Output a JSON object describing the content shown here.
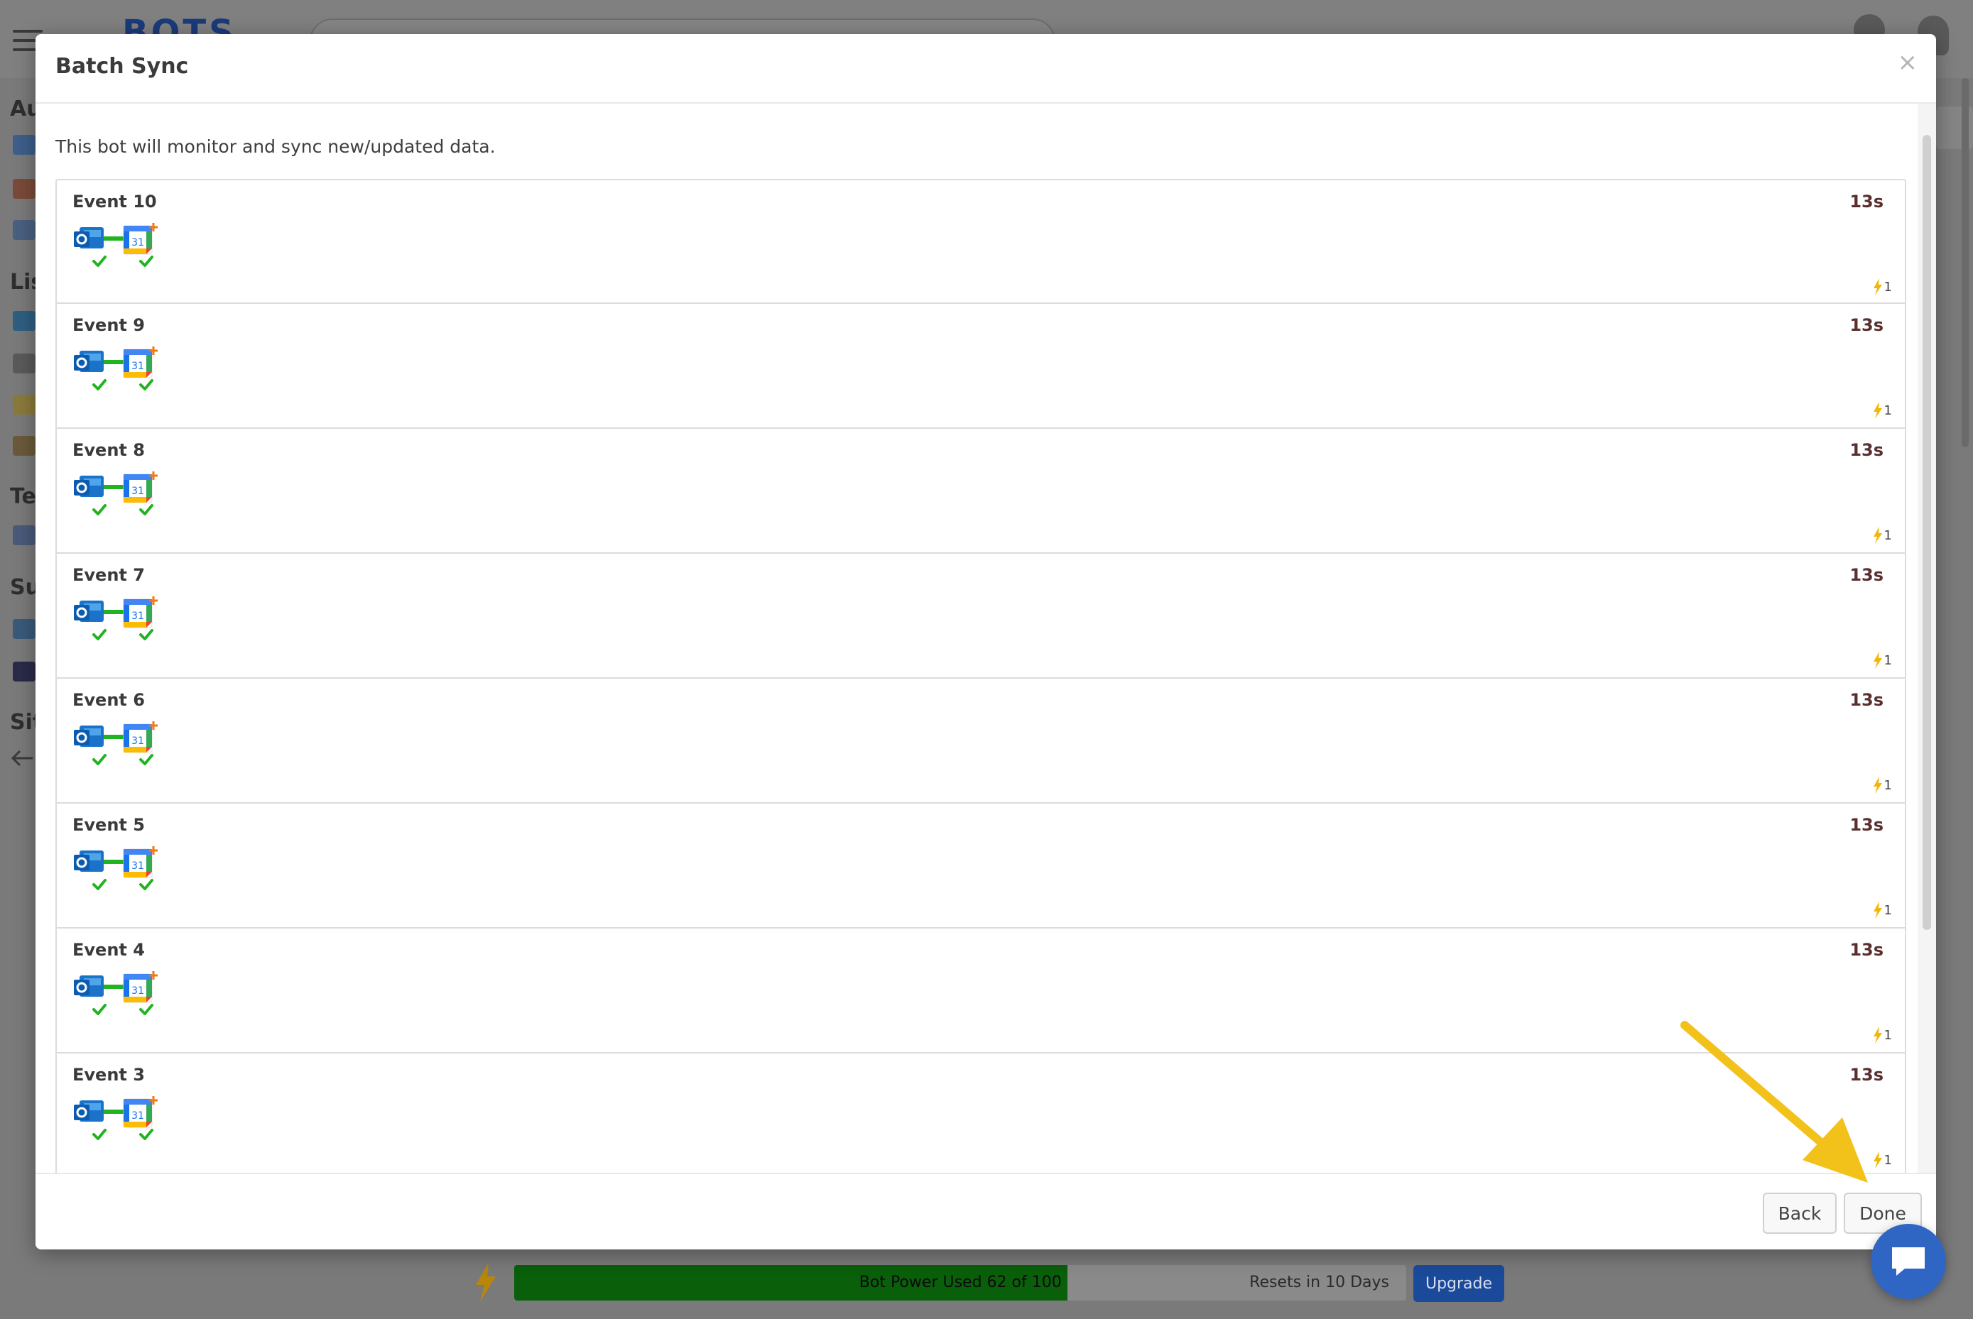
{
  "app": {
    "logo_text": "BOTS",
    "sidebar_headers": [
      "Au",
      "Lis",
      "Te",
      "Su",
      "Sit"
    ]
  },
  "modal": {
    "title": "Batch Sync",
    "close_glyph": "×",
    "intro": "This bot will monitor and sync new/updated data.",
    "events": [
      {
        "name": "Event 10",
        "time": "13s",
        "power": "1"
      },
      {
        "name": "Event 9",
        "time": "13s",
        "power": "1"
      },
      {
        "name": "Event 8",
        "time": "13s",
        "power": "1"
      },
      {
        "name": "Event 7",
        "time": "13s",
        "power": "1"
      },
      {
        "name": "Event 6",
        "time": "13s",
        "power": "1"
      },
      {
        "name": "Event 5",
        "time": "13s",
        "power": "1"
      },
      {
        "name": "Event 4",
        "time": "13s",
        "power": "1"
      },
      {
        "name": "Event 3",
        "time": "13s",
        "power": "1"
      }
    ],
    "icons": {
      "source": "outlook-icon",
      "target": "google-calendar-icon",
      "target_day": "31"
    },
    "footer": {
      "back_label": "Back",
      "done_label": "Done"
    }
  },
  "bot_power": {
    "label": "Bot Power Used 62 of 100",
    "used": 62,
    "total": 100,
    "resets": "Resets in 10 Days",
    "upgrade_label": "Upgrade"
  },
  "colors": {
    "accent_check": "#22b322",
    "power_bolt": "#f2b705",
    "annotation_arrow": "#f2c11a",
    "chat_blue": "#2f66c4"
  }
}
